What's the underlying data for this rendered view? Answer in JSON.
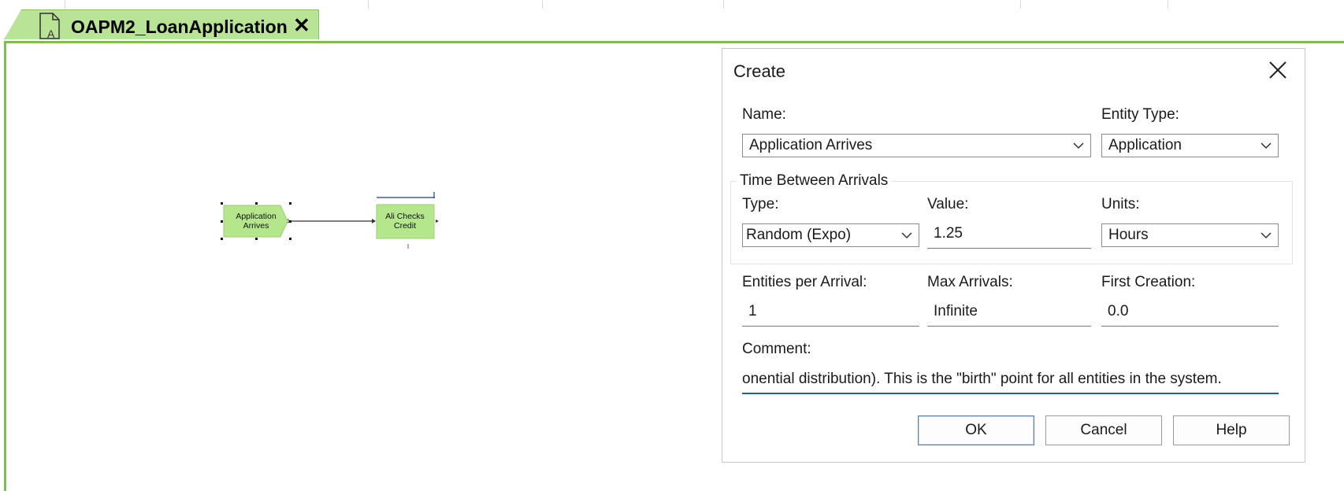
{
  "document_tab": {
    "title": "OAPM2_LoanApplication",
    "close_label": "✕"
  },
  "flowchart": {
    "modules": [
      {
        "label_line1": "Application",
        "label_line2": "Arrives"
      },
      {
        "label_line1": "Ali Checks",
        "label_line2": "Credit"
      }
    ]
  },
  "dialog": {
    "title": "Create",
    "name": {
      "label": "Name:",
      "value": "Application Arrives"
    },
    "entity_type": {
      "label": "Entity Type:",
      "value": "Application"
    },
    "time_between_arrivals": {
      "group_label": "Time Between Arrivals",
      "type": {
        "label": "Type:",
        "value": "Random (Expo)"
      },
      "value": {
        "label": "Value:",
        "value": "1.25"
      },
      "units": {
        "label": "Units:",
        "value": "Hours"
      }
    },
    "entities_per_arrival": {
      "label": "Entities per Arrival:",
      "value": "1"
    },
    "max_arrivals": {
      "label": "Max Arrivals:",
      "value": "Infinite"
    },
    "first_creation": {
      "label": "First Creation:",
      "value": "0.0"
    },
    "comment": {
      "label": "Comment:",
      "value": "onential distribution). This is the \"birth\" point for all entities in the system."
    },
    "buttons": {
      "ok": "OK",
      "cancel": "Cancel",
      "help": "Help"
    }
  },
  "colors": {
    "module_fill": "#b4e68c",
    "tab_fill": "#b9e495",
    "canvas_border": "#7bbf4c",
    "focus_underline": "#1f5fa8"
  }
}
